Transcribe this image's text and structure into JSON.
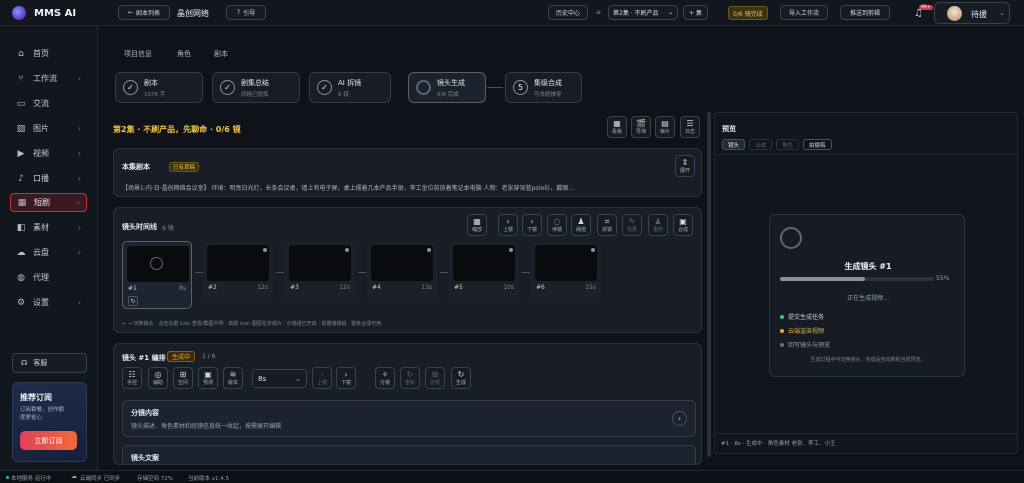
{
  "app": {
    "name": "MMS AI"
  },
  "topbar": {
    "back_label": "剧本列表",
    "project_title": "晶创网络",
    "guide_label": "引导",
    "history_label": "历史中心",
    "episode_select": "第2集 · 不刷产品",
    "add_episode_label": "+ 集",
    "progress_badge": "0/6 镜完成",
    "import_label": "导入工作流",
    "push_label": "推送到剪辑",
    "notif_count": "99+",
    "username": "待援"
  },
  "sidebar": {
    "items": [
      {
        "label": "首页",
        "icon": "home-icon",
        "glyph": "⌂"
      },
      {
        "label": "工作流",
        "icon": "workflow-icon",
        "glyph": "⑂",
        "chevron": "›"
      },
      {
        "label": "交流",
        "icon": "chat-icon",
        "glyph": "▭"
      },
      {
        "label": "图片",
        "icon": "image-icon",
        "glyph": "▨",
        "chevron": "›"
      },
      {
        "label": "视频",
        "icon": "video-icon",
        "glyph": "▶",
        "chevron": "›"
      },
      {
        "label": "口播",
        "icon": "mic-icon",
        "glyph": "♪",
        "chevron": "›"
      },
      {
        "label": "短剧",
        "icon": "film-icon",
        "glyph": "▦",
        "chevron": "›"
      },
      {
        "label": "素材",
        "icon": "folder-icon",
        "glyph": "◧",
        "chevron": "›"
      },
      {
        "label": "云盘",
        "icon": "cloud-icon",
        "glyph": "☁",
        "chevron": "›"
      },
      {
        "label": "代理",
        "icon": "agent-icon",
        "glyph": "◍"
      },
      {
        "label": "设置",
        "icon": "gear-icon",
        "glyph": "⚙",
        "chevron": "›"
      }
    ],
    "support_label": "客服",
    "promo": {
      "title": "推荐订阅",
      "desc": "订阅套餐，创作额度更省心",
      "button": "立即订阅"
    }
  },
  "tabs": [
    "项目信息",
    "角色",
    "剧本"
  ],
  "steps": [
    {
      "title": "剧本",
      "sub": "1076 字",
      "state": "done"
    },
    {
      "title": "剧集总结",
      "sub": "风格已提炼",
      "state": "done"
    },
    {
      "title": "AI 拆镜",
      "sub": "6 镜",
      "state": "done"
    },
    {
      "title": "镜头生成",
      "sub": "0/6 完成",
      "state": "active"
    },
    {
      "title": "集级合成",
      "sub": "可本剧推导",
      "state": "pending",
      "num": "5"
    }
  ],
  "episode_header": "第2集 · 不刷产品，先聊命 · 0/6 镜",
  "header_tools": [
    {
      "label": "看板",
      "glyph": "▦"
    },
    {
      "label": "导演",
      "glyph": "🎬"
    },
    {
      "label": "审片",
      "glyph": "▤"
    },
    {
      "label": "日志",
      "glyph": "☰"
    }
  ],
  "script_card": {
    "title": "本集剧本",
    "badge": "已有草稿",
    "expand_label": "展开",
    "text": "【场景1:内·日·晶创网络会议室】 环境：明亮日光灯，长条会议桌，墙上有电子屏，桌上摆着几本产品手册，李工坐位前放着笔记本电脑 人物：老张穿深蓝polo衫，戴眼..."
  },
  "timeline": {
    "title": "镜头时间线",
    "count": "6 镜",
    "tools": [
      {
        "label": "缩放",
        "glyph": "▦"
      },
      {
        "label": "上镜",
        "glyph": "‹"
      },
      {
        "label": "下镜",
        "glyph": "›"
      },
      {
        "label": "待镜",
        "glyph": "◌"
      },
      {
        "label": "阈值",
        "glyph": "♟"
      },
      {
        "label": "拆镜",
        "glyph": "⌗"
      },
      {
        "label": "批量",
        "glyph": "✎",
        "disabled": true
      },
      {
        "label": "重命",
        "glyph": "♟",
        "disabled": true
      },
      {
        "label": "合成",
        "glyph": "▣"
      }
    ],
    "shots": [
      {
        "num": "#1",
        "dur": "8s"
      },
      {
        "num": "#2",
        "dur": "12s"
      },
      {
        "num": "#3",
        "dur": "12s"
      },
      {
        "num": "#4",
        "dur": "13s"
      },
      {
        "num": "#5",
        "dur": "10s"
      },
      {
        "num": "#6",
        "dur": "15s"
      }
    ],
    "hint": "← → 切换镜头 · 点击右键 icon 查看/截图不明 · 高颜 icon 图层任务成片 · 示镜组已开启 · 前期储镜组 · 整条合成可用"
  },
  "editor": {
    "title": "镜头 #1 编排",
    "status": "生成中",
    "pager": "1 / 6",
    "tools": [
      {
        "label": "手控",
        "glyph": "☷"
      },
      {
        "label": "辅助",
        "glyph": "◎"
      },
      {
        "label": "空间",
        "glyph": "⊞"
      },
      {
        "label": "预测",
        "glyph": "▣"
      },
      {
        "label": "版本",
        "glyph": "≋"
      }
    ],
    "duration_value": "8s",
    "nav": [
      {
        "label": "上镜",
        "glyph": "‹",
        "disabled": true
      },
      {
        "label": "下镜",
        "glyph": "›"
      }
    ],
    "actions": [
      {
        "label": "分镜",
        "glyph": "✧"
      },
      {
        "label": "重新",
        "glyph": "↻",
        "disabled": true
      },
      {
        "label": "音频",
        "glyph": "⊞",
        "disabled": true
      },
      {
        "label": "生成",
        "glyph": "↻"
      }
    ],
    "content_section": {
      "title": "分镜内容",
      "desc": "镜头描述、角色素材和组镜信息统一收起，按需展开编辑"
    },
    "next_section_title": "镜头文案"
  },
  "preview": {
    "title": "预览",
    "tabs": [
      "镜头",
      "合成",
      "角色",
      "拍摄稿"
    ],
    "gen_title": "生成镜头 #1",
    "percent": "55%",
    "progress": 0.55,
    "status": "正在生成视频...",
    "checklist": [
      {
        "label": "提交生成任务",
        "state": "done"
      },
      {
        "label": "云端渲染视频",
        "state": "active"
      },
      {
        "label": "回写镜头与预览",
        "state": "pending"
      }
    ],
    "note": "生成过程中可切换镜头，完成后自动刷新当前预览。",
    "footer": "#1 · 8s · 生成中 · 角色素材 老张、李工、小王"
  },
  "statusbar": {
    "service": "本地服务 运行中",
    "cloud": "云端同步 已同步",
    "storage": "存储空间 72%",
    "version": "当前版本 v1.4.5"
  }
}
